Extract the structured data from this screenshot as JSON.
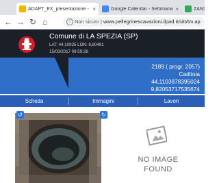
{
  "browser": {
    "tabs": [
      {
        "title": "ADAPT_EX_presentazione - Go",
        "icon_color": "#f4b400"
      },
      {
        "title": "Google Calendar - Settimana di",
        "icon_color": "#4285f4"
      },
      {
        "title": "ZANS",
        "icon_color": "#34a853"
      }
    ],
    "close_glyph": "×",
    "security_label": "Non sicuro",
    "url": "www.pellegrinescavazioni.ilpad.it/sitt/tm.ap"
  },
  "record": {
    "title": "Comune di LA SPEZIA (SP)",
    "coords_line": "LAT: 44,10925 LON: 9,80491",
    "timestamp": "15/03/2017 09:59:28",
    "id_line": "2189 ( progr. 2057)",
    "type": "Caditoia",
    "lat": "44,1103878395024",
    "lon": "9,82053717535674",
    "icon": "hydrant-icon",
    "accent_color": "#d41c2a"
  },
  "tabs": [
    "Scheda",
    "Immagini",
    "Lavori"
  ],
  "placeholder": {
    "line1": "NO IMAGE",
    "line2": "FOUND"
  }
}
